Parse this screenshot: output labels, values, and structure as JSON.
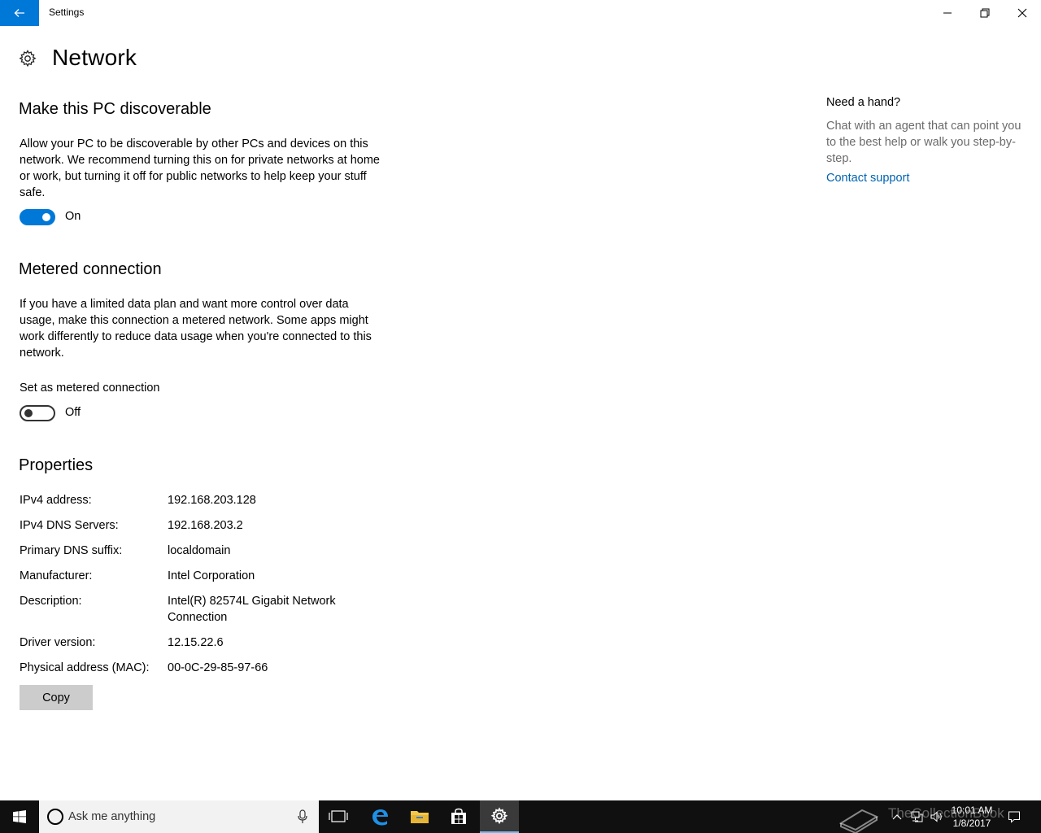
{
  "window": {
    "title": "Settings"
  },
  "page": {
    "title": "Network"
  },
  "discoverable": {
    "title": "Make this PC discoverable",
    "description": "Allow your PC to be discoverable by other PCs and devices on this network. We recommend turning this on for private networks at home or work, but turning it off for public networks to help keep your stuff safe.",
    "toggle_state": "On"
  },
  "metered": {
    "title": "Metered connection",
    "description": "If you have a limited data plan and want more control over data usage, make this connection a metered network. Some apps might work differently to reduce data usage when you're connected to this network.",
    "setting_label": "Set as metered connection",
    "toggle_state": "Off"
  },
  "properties": {
    "title": "Properties",
    "rows": [
      {
        "key": "IPv4 address:",
        "value": "192.168.203.128"
      },
      {
        "key": "IPv4 DNS Servers:",
        "value": "192.168.203.2"
      },
      {
        "key": "Primary DNS suffix:",
        "value": "localdomain"
      },
      {
        "key": "Manufacturer:",
        "value": "Intel Corporation"
      },
      {
        "key": "Description:",
        "value": "Intel(R) 82574L Gigabit Network Connection"
      },
      {
        "key": "Driver version:",
        "value": "12.15.22.6"
      },
      {
        "key": "Physical address (MAC):",
        "value": "00-0C-29-85-97-66"
      }
    ],
    "copy_label": "Copy"
  },
  "help": {
    "title": "Need a hand?",
    "text": "Chat with an agent that can point you to the best help or walk you step-by-step.",
    "link": "Contact support"
  },
  "taskbar": {
    "search_placeholder": "Ask me anything",
    "clock_time": "10:01 AM",
    "clock_date": "1/8/2017",
    "watermark": "TheCollectionBook",
    "icons": [
      "windows-start-icon",
      "task-view-icon",
      "edge-icon",
      "file-explorer-icon",
      "store-icon",
      "settings-icon"
    ]
  },
  "colors": {
    "accent": "#0078d7",
    "link": "#0063b1",
    "taskbar": "#101010"
  }
}
